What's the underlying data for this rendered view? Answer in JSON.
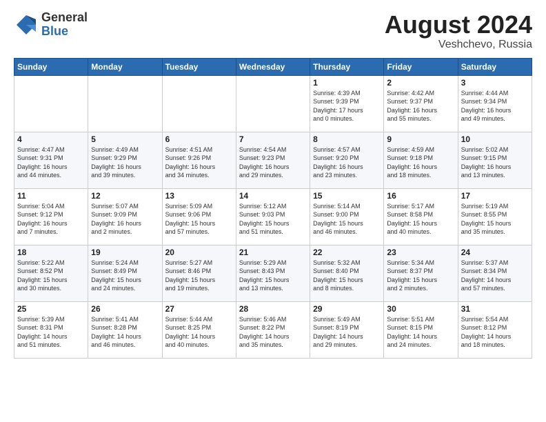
{
  "header": {
    "logo_general": "General",
    "logo_blue": "Blue",
    "month_year": "August 2024",
    "location": "Veshchevo, Russia"
  },
  "calendar": {
    "days_of_week": [
      "Sunday",
      "Monday",
      "Tuesday",
      "Wednesday",
      "Thursday",
      "Friday",
      "Saturday"
    ],
    "weeks": [
      [
        {
          "day": "",
          "info": ""
        },
        {
          "day": "",
          "info": ""
        },
        {
          "day": "",
          "info": ""
        },
        {
          "day": "",
          "info": ""
        },
        {
          "day": "1",
          "info": "Sunrise: 4:39 AM\nSunset: 9:39 PM\nDaylight: 17 hours\nand 0 minutes."
        },
        {
          "day": "2",
          "info": "Sunrise: 4:42 AM\nSunset: 9:37 PM\nDaylight: 16 hours\nand 55 minutes."
        },
        {
          "day": "3",
          "info": "Sunrise: 4:44 AM\nSunset: 9:34 PM\nDaylight: 16 hours\nand 49 minutes."
        }
      ],
      [
        {
          "day": "4",
          "info": "Sunrise: 4:47 AM\nSunset: 9:31 PM\nDaylight: 16 hours\nand 44 minutes."
        },
        {
          "day": "5",
          "info": "Sunrise: 4:49 AM\nSunset: 9:29 PM\nDaylight: 16 hours\nand 39 minutes."
        },
        {
          "day": "6",
          "info": "Sunrise: 4:51 AM\nSunset: 9:26 PM\nDaylight: 16 hours\nand 34 minutes."
        },
        {
          "day": "7",
          "info": "Sunrise: 4:54 AM\nSunset: 9:23 PM\nDaylight: 16 hours\nand 29 minutes."
        },
        {
          "day": "8",
          "info": "Sunrise: 4:57 AM\nSunset: 9:20 PM\nDaylight: 16 hours\nand 23 minutes."
        },
        {
          "day": "9",
          "info": "Sunrise: 4:59 AM\nSunset: 9:18 PM\nDaylight: 16 hours\nand 18 minutes."
        },
        {
          "day": "10",
          "info": "Sunrise: 5:02 AM\nSunset: 9:15 PM\nDaylight: 16 hours\nand 13 minutes."
        }
      ],
      [
        {
          "day": "11",
          "info": "Sunrise: 5:04 AM\nSunset: 9:12 PM\nDaylight: 16 hours\nand 7 minutes."
        },
        {
          "day": "12",
          "info": "Sunrise: 5:07 AM\nSunset: 9:09 PM\nDaylight: 16 hours\nand 2 minutes."
        },
        {
          "day": "13",
          "info": "Sunrise: 5:09 AM\nSunset: 9:06 PM\nDaylight: 15 hours\nand 57 minutes."
        },
        {
          "day": "14",
          "info": "Sunrise: 5:12 AM\nSunset: 9:03 PM\nDaylight: 15 hours\nand 51 minutes."
        },
        {
          "day": "15",
          "info": "Sunrise: 5:14 AM\nSunset: 9:00 PM\nDaylight: 15 hours\nand 46 minutes."
        },
        {
          "day": "16",
          "info": "Sunrise: 5:17 AM\nSunset: 8:58 PM\nDaylight: 15 hours\nand 40 minutes."
        },
        {
          "day": "17",
          "info": "Sunrise: 5:19 AM\nSunset: 8:55 PM\nDaylight: 15 hours\nand 35 minutes."
        }
      ],
      [
        {
          "day": "18",
          "info": "Sunrise: 5:22 AM\nSunset: 8:52 PM\nDaylight: 15 hours\nand 30 minutes."
        },
        {
          "day": "19",
          "info": "Sunrise: 5:24 AM\nSunset: 8:49 PM\nDaylight: 15 hours\nand 24 minutes."
        },
        {
          "day": "20",
          "info": "Sunrise: 5:27 AM\nSunset: 8:46 PM\nDaylight: 15 hours\nand 19 minutes."
        },
        {
          "day": "21",
          "info": "Sunrise: 5:29 AM\nSunset: 8:43 PM\nDaylight: 15 hours\nand 13 minutes."
        },
        {
          "day": "22",
          "info": "Sunrise: 5:32 AM\nSunset: 8:40 PM\nDaylight: 15 hours\nand 8 minutes."
        },
        {
          "day": "23",
          "info": "Sunrise: 5:34 AM\nSunset: 8:37 PM\nDaylight: 15 hours\nand 2 minutes."
        },
        {
          "day": "24",
          "info": "Sunrise: 5:37 AM\nSunset: 8:34 PM\nDaylight: 14 hours\nand 57 minutes."
        }
      ],
      [
        {
          "day": "25",
          "info": "Sunrise: 5:39 AM\nSunset: 8:31 PM\nDaylight: 14 hours\nand 51 minutes."
        },
        {
          "day": "26",
          "info": "Sunrise: 5:41 AM\nSunset: 8:28 PM\nDaylight: 14 hours\nand 46 minutes."
        },
        {
          "day": "27",
          "info": "Sunrise: 5:44 AM\nSunset: 8:25 PM\nDaylight: 14 hours\nand 40 minutes."
        },
        {
          "day": "28",
          "info": "Sunrise: 5:46 AM\nSunset: 8:22 PM\nDaylight: 14 hours\nand 35 minutes."
        },
        {
          "day": "29",
          "info": "Sunrise: 5:49 AM\nSunset: 8:19 PM\nDaylight: 14 hours\nand 29 minutes."
        },
        {
          "day": "30",
          "info": "Sunrise: 5:51 AM\nSunset: 8:15 PM\nDaylight: 14 hours\nand 24 minutes."
        },
        {
          "day": "31",
          "info": "Sunrise: 5:54 AM\nSunset: 8:12 PM\nDaylight: 14 hours\nand 18 minutes."
        }
      ]
    ]
  }
}
